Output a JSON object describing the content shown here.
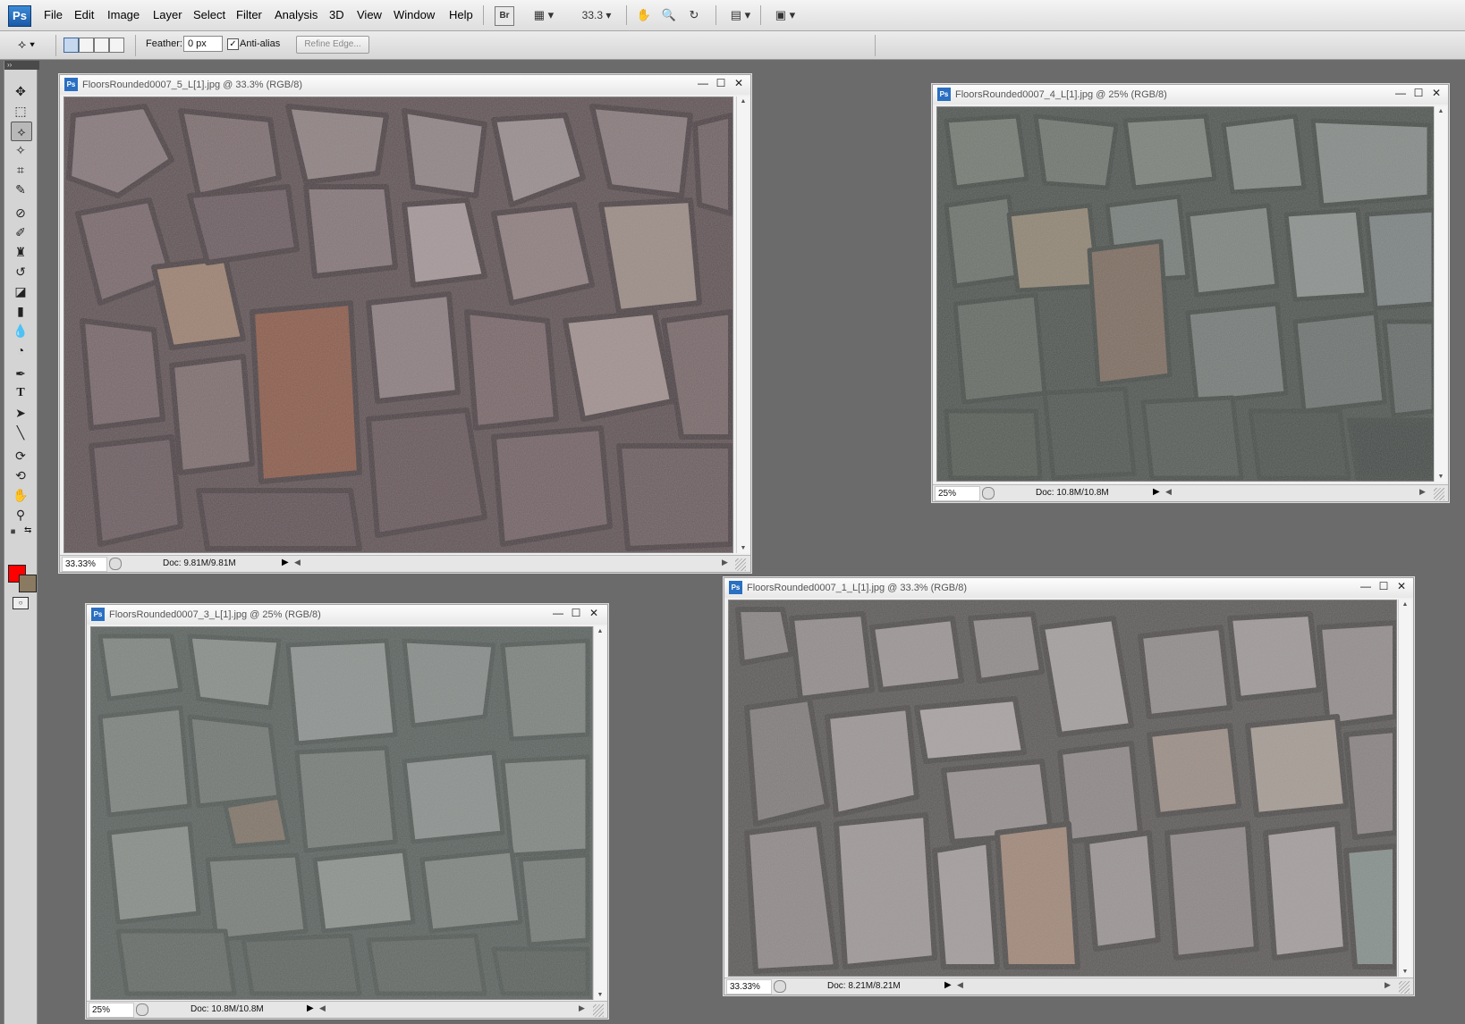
{
  "app": {
    "logo": "Ps",
    "menu": [
      "File",
      "Edit",
      "Image",
      "Layer",
      "Select",
      "Filter",
      "Analysis",
      "3D",
      "View",
      "Window",
      "Help"
    ],
    "bridge_label": "Br",
    "zoom_menu_value": "33.3",
    "accent_color": "#1a5aa8"
  },
  "options": {
    "feather_label": "Feather:",
    "feather_value": "0 px",
    "antialias_label": "Anti-alias",
    "antialias_checked": true,
    "refine_label": "Refine Edge..."
  },
  "tools": {
    "foreground_color": "#ff0000",
    "background_color": "#8a7a62",
    "text_tool_glyph": "T"
  },
  "windows": [
    {
      "title": "FloorsRounded0007_5_L[1].jpg @ 33.3% (RGB/8)",
      "zoom": "33.33%",
      "doc": "Doc: 9.81M/9.81M",
      "tone": "warm-brown"
    },
    {
      "title": "FloorsRounded0007_4_L[1].jpg @ 25% (RGB/8)",
      "zoom": "25%",
      "doc": "Doc: 10.8M/10.8M",
      "tone": "grey-green"
    },
    {
      "title": "FloorsRounded0007_3_L[1].jpg @ 25% (RGB/8)",
      "zoom": "25%",
      "doc": "Doc: 10.8M/10.8M",
      "tone": "grey-green-light"
    },
    {
      "title": "FloorsRounded0007_1_L[1].jpg @ 33.3% (RGB/8)",
      "zoom": "33.33%",
      "doc": "Doc: 8.21M/8.21M",
      "tone": "grey-beige"
    }
  ]
}
